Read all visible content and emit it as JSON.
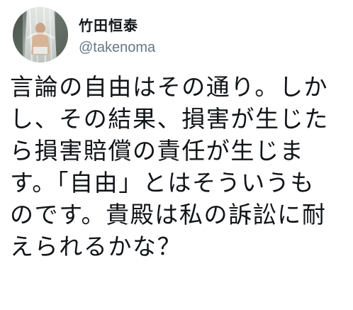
{
  "tweet": {
    "author": {
      "display_name": "竹田恒泰",
      "username": "@takenoma"
    },
    "body_lines": [
      "言論の自由はその通り。しか",
      "し、その結果、損害が生じた",
      "ら損害賠償の責任が生じま",
      "す。「自由」とはそういうも",
      "のです。貴殿は私の訴訟に耐",
      "えられるかな？"
    ]
  }
}
